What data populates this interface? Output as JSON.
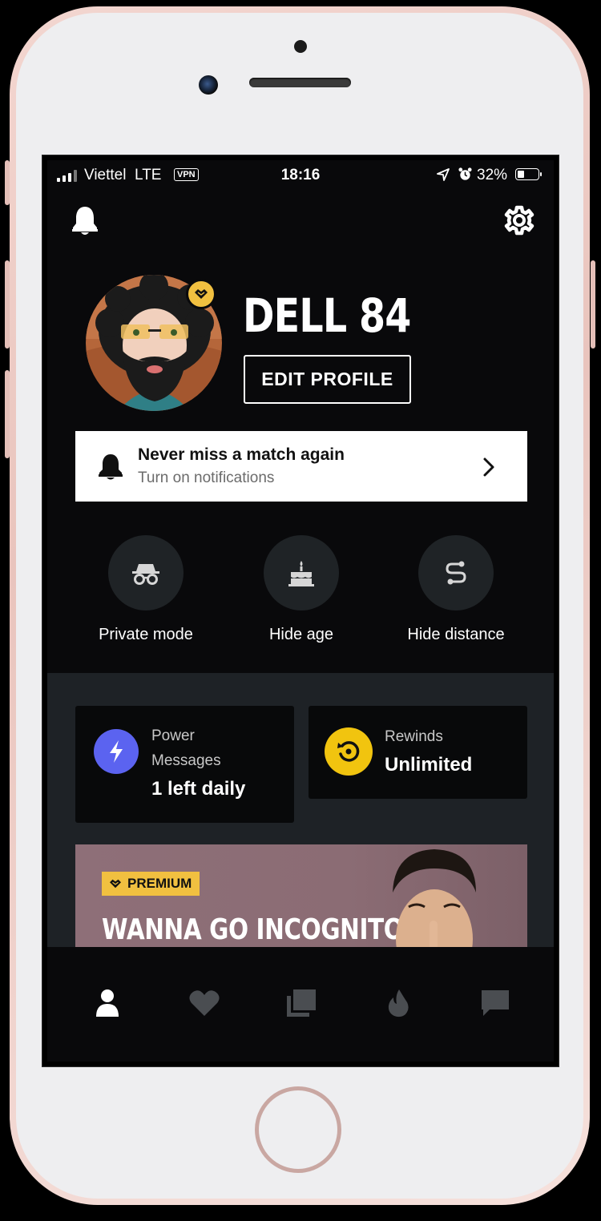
{
  "status_bar": {
    "carrier": "Viettel",
    "network": "LTE",
    "vpn": "VPN",
    "time": "18:16",
    "battery_pct": "32%",
    "battery_level": 0.32
  },
  "header": {
    "left_icon": "bell-icon",
    "right_icon": "gear-icon"
  },
  "profile": {
    "name": "DELL 84",
    "edit_label": "EDIT PROFILE",
    "badge_icon": "premium-diamond-icon"
  },
  "notification_banner": {
    "title": "Never miss a match again",
    "subtitle": "Turn on notifications"
  },
  "toggles": [
    {
      "label": "Private mode",
      "icon": "incognito-icon"
    },
    {
      "label": "Hide age",
      "icon": "cake-icon"
    },
    {
      "label": "Hide distance",
      "icon": "route-icon"
    }
  ],
  "cards": {
    "power": {
      "line1": "Power",
      "line2": "Messages",
      "value": "1 left daily",
      "color": "#5b63f0"
    },
    "rewinds": {
      "line1": "Rewinds",
      "value": "Unlimited",
      "color": "#f1c40f"
    }
  },
  "promo": {
    "tag": "PREMIUM",
    "title": "WANNA GO INCOGNITO?"
  },
  "tabs": [
    {
      "name": "profile",
      "icon": "person-icon",
      "active": true
    },
    {
      "name": "likes",
      "icon": "heart-icon",
      "active": false
    },
    {
      "name": "explore",
      "icon": "cards-icon",
      "active": false
    },
    {
      "name": "discover",
      "icon": "flame-icon",
      "active": false
    },
    {
      "name": "messages",
      "icon": "chat-icon",
      "active": false
    }
  ],
  "colors": {
    "accent_gold": "#f1c040",
    "background": "#09090b",
    "section_bg": "#1e2226"
  }
}
